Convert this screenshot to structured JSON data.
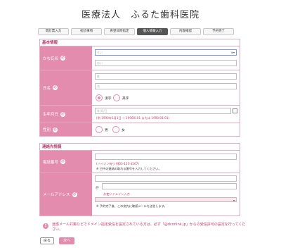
{
  "header": {
    "title": "医療法人　ふるた歯科医院"
  },
  "steps": [
    {
      "label": "問診票入力"
    },
    {
      "label": "初診事項"
    },
    {
      "label": "希望日時指定"
    },
    {
      "label": "個人情報入力"
    },
    {
      "label": "内容確認"
    },
    {
      "label": "予約完了"
    }
  ],
  "basic": {
    "heading": "基本情報",
    "kana": {
      "label": "かな氏名",
      "placeholder_last": "せい",
      "placeholder_first": "めい"
    },
    "name": {
      "label": "氏名",
      "placeholder_last": "姓",
      "placeholder_first": "名"
    },
    "name_type": {
      "option1": "漢字",
      "option2": "英字"
    },
    "birthday": {
      "label": "生年月日",
      "placeholder": "年/月/日",
      "hint": "(例 1990年1月1日 → 19900101 または 1990/01/01)"
    },
    "gender": {
      "label": "性別",
      "male": "男",
      "female": "女"
    }
  },
  "contact": {
    "heading": "連絡先情報",
    "phone": {
      "label": "電話番号",
      "hint": "(ハイフン有り 例03-123-4567)",
      "note": "※ 日中の連絡の取れる番号を入力してください。"
    },
    "email": {
      "label": "メールアドレス",
      "at": "＠",
      "domain_hint": "お使いドメイン入力",
      "note": "※ 予約完了後、この宛先に確認メールを送信します。"
    }
  },
  "warning": {
    "icon": "!",
    "text": "迷惑メール対策などでドメイン指定受信を設定されている方は、必ず「@dcorlink.jp」からの受信許可の設定を行ってください。"
  },
  "buttons": {
    "back": "戻る",
    "next": "次へ"
  }
}
